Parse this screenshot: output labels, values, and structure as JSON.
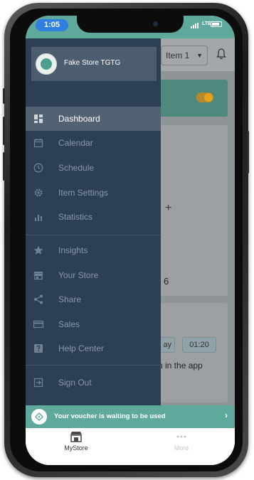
{
  "status_bar": {
    "time": "1:05",
    "network": "LTE"
  },
  "app_behind": {
    "item_select": "Item 1",
    "number_fragment": "6",
    "chip_day": "ay",
    "chip_time": "01:20",
    "text_fragment": "n in the app"
  },
  "drawer": {
    "store_name": "Fake Store TGTG",
    "items": [
      {
        "label": "Dashboard",
        "icon": "dashboard-icon",
        "active": true
      },
      {
        "label": "Calendar",
        "icon": "calendar-icon"
      },
      {
        "label": "Schedule",
        "icon": "clock-icon"
      },
      {
        "label": "Item Settings",
        "icon": "gear-icon"
      },
      {
        "label": "Statistics",
        "icon": "bar-chart-icon"
      },
      {
        "label": "Insights",
        "icon": "star-icon"
      },
      {
        "label": "Your Store",
        "icon": "store-icon"
      },
      {
        "label": "Share",
        "icon": "share-icon"
      },
      {
        "label": "Sales",
        "icon": "credit-card-icon"
      },
      {
        "label": "Help Center",
        "icon": "help-icon"
      },
      {
        "label": "Sign Out",
        "icon": "sign-out-icon"
      }
    ]
  },
  "voucher": {
    "text": "Your voucher is waiting to be used",
    "chevron": "›"
  },
  "tabbar": {
    "tabs": [
      {
        "label": "MyStore",
        "icon": "store-icon"
      },
      {
        "label": "More",
        "icon": "dots-icon"
      }
    ]
  },
  "colors": {
    "accent": "#5fa99c",
    "drawer_bg": "#2d3f55",
    "drawer_active": "#536273",
    "time_pill": "#2f7ee0"
  }
}
